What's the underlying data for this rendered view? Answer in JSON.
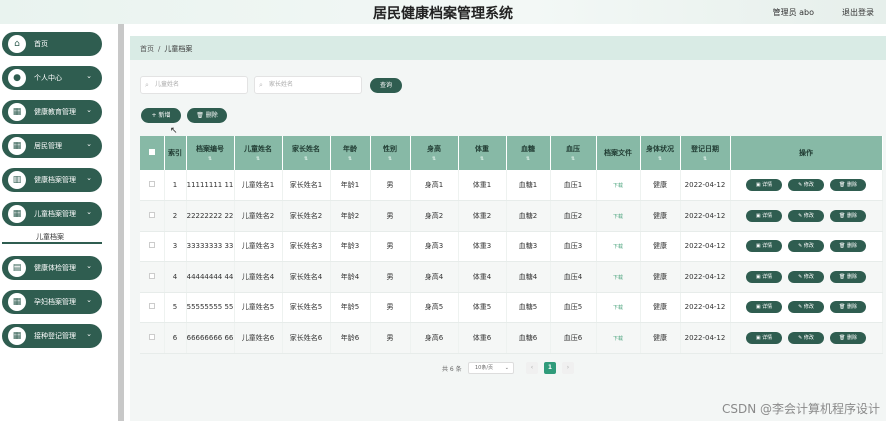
{
  "app": {
    "title": "居民健康档案管理系统",
    "user": "管理员 abo",
    "logout": "退出登录"
  },
  "sidebar": {
    "items": [
      {
        "label": "首页",
        "icon": "home-icon",
        "glyph": "⌂",
        "arrow": ""
      },
      {
        "label": "个人中心",
        "icon": "user-icon",
        "glyph": "●",
        "arrow": "⌄"
      },
      {
        "label": "健康教育管理",
        "icon": "grid-icon",
        "glyph": "▦",
        "arrow": "⌄"
      },
      {
        "label": "居民管理",
        "icon": "grid-icon",
        "glyph": "▦",
        "arrow": "⌄"
      },
      {
        "label": "健康档案管理",
        "icon": "chart-icon",
        "glyph": "▥",
        "arrow": "⌄"
      },
      {
        "label": "儿童档案管理",
        "icon": "grid-icon",
        "glyph": "▦",
        "arrow": "⌄"
      },
      {
        "label": "健康体检管理",
        "icon": "list-icon",
        "glyph": "▤",
        "arrow": "⌄"
      },
      {
        "label": "孕妇档案管理",
        "icon": "grid-icon",
        "glyph": "▦",
        "arrow": "⌄"
      },
      {
        "label": "接种登记管理",
        "icon": "grid-icon",
        "glyph": "▦",
        "arrow": "⌄"
      }
    ],
    "sub_item": "儿童档案"
  },
  "breadcrumb": {
    "home": "首页",
    "sep": "/",
    "current": "儿童档案"
  },
  "search": {
    "child_name_placeholder": "儿童姓名",
    "parent_name_placeholder": "家长姓名",
    "query_label": "查询"
  },
  "actions": {
    "add_label": "新增",
    "delete_label": "删除"
  },
  "table": {
    "headers": [
      "索引",
      "档案编号",
      "儿童姓名",
      "家长姓名",
      "年龄",
      "性别",
      "身高",
      "体重",
      "血糖",
      "血压",
      "档案文件",
      "身体状况",
      "登记日期",
      "操作"
    ],
    "rows": [
      [
        "1",
        "11111111 11",
        "儿童姓名1",
        "家长姓名1",
        "年龄1",
        "男",
        "身高1",
        "体重1",
        "血糖1",
        "血压1",
        "下载",
        "健康",
        "2022-04-12"
      ],
      [
        "2",
        "22222222 22",
        "儿童姓名2",
        "家长姓名2",
        "年龄2",
        "男",
        "身高2",
        "体重2",
        "血糖2",
        "血压2",
        "下载",
        "健康",
        "2022-04-12"
      ],
      [
        "3",
        "33333333 33",
        "儿童姓名3",
        "家长姓名3",
        "年龄3",
        "男",
        "身高3",
        "体重3",
        "血糖3",
        "血压3",
        "下载",
        "健康",
        "2022-04-12"
      ],
      [
        "4",
        "44444444 44",
        "儿童姓名4",
        "家长姓名4",
        "年龄4",
        "男",
        "身高4",
        "体重4",
        "血糖4",
        "血压4",
        "下载",
        "健康",
        "2022-04-12"
      ],
      [
        "5",
        "55555555 55",
        "儿童姓名5",
        "家长姓名5",
        "年龄5",
        "男",
        "身高5",
        "体重5",
        "血糖5",
        "血压5",
        "下载",
        "健康",
        "2022-04-12"
      ],
      [
        "6",
        "66666666 66",
        "儿童姓名6",
        "家长姓名6",
        "年龄6",
        "男",
        "身高6",
        "体重6",
        "血糖6",
        "血压6",
        "下载",
        "健康",
        "2022-04-12"
      ]
    ],
    "row_actions": [
      "详情",
      "修改",
      "删除"
    ]
  },
  "pagination": {
    "total": "共 6 条",
    "page_size": "10条/页",
    "current_page": "1",
    "prev": "‹",
    "next": "›"
  },
  "watermark": "CSDN @李会计算机程序设计",
  "colors": {
    "primary": "#2f5d50",
    "table_header": "#87b9a6",
    "breadcrumb_bg": "#d9ebe5"
  }
}
